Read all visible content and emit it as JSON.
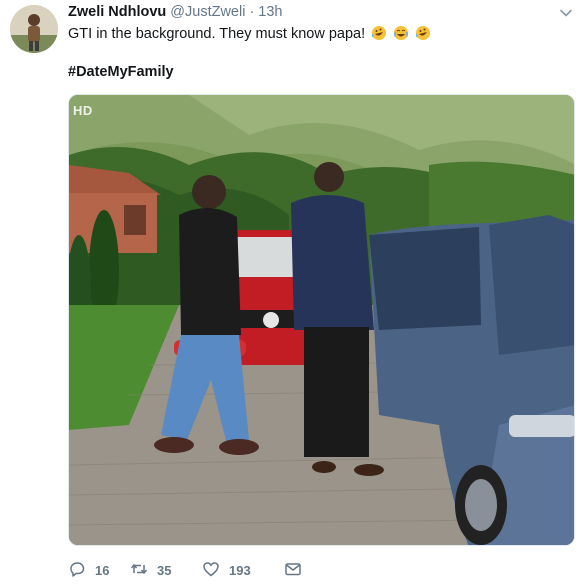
{
  "user": {
    "display_name": "Zweli Ndhlovu",
    "handle": "@JustZweli",
    "separator": "·",
    "time": "13h"
  },
  "tweet": {
    "text": "GTI in the background. They must know papa!",
    "emojis": [
      "rolling-on-floor-laughing-emoji",
      "tears-of-joy-emoji",
      "rolling-on-floor-laughing-emoji"
    ],
    "hashtag": "#DateMyFamily"
  },
  "media": {
    "watermark": "HD",
    "description_icon": "video-frame"
  },
  "actions": {
    "replies": "16",
    "retweets": "35",
    "likes": "193"
  },
  "icons": {
    "reply": "reply-icon",
    "retweet": "retweet-icon",
    "like": "heart-icon",
    "dm": "envelope-icon",
    "menu": "chevron-down-icon"
  },
  "colors": {
    "text": "#14171a",
    "muted": "#657786",
    "border": "#e1e8ed"
  }
}
